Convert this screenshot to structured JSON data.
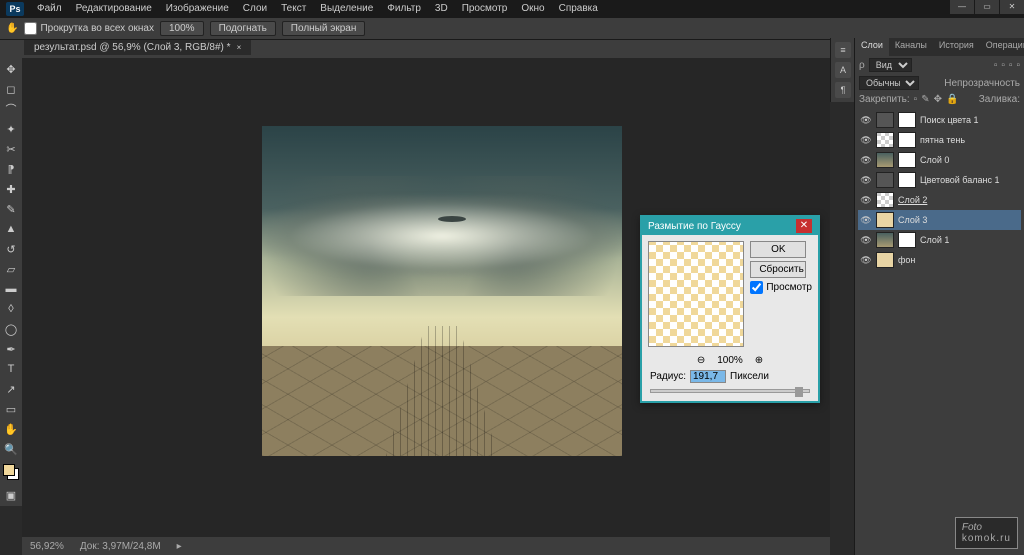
{
  "app": {
    "logo": "Ps"
  },
  "menu": [
    "Файл",
    "Редактирование",
    "Изображение",
    "Слои",
    "Текст",
    "Выделение",
    "Фильтр",
    "3D",
    "Просмотр",
    "Окно",
    "Справка"
  ],
  "options": {
    "scroll_all": "Прокрутка во всех окнах",
    "zoom": "100%",
    "fit": "Подогнать",
    "full": "Полный экран"
  },
  "doc_tab": "результат.psd @ 56,9% (Слой 3, RGB/8#) *",
  "dialog": {
    "title": "Размытие по Гауссу",
    "ok": "OK",
    "reset": "Сбросить",
    "preview": "Просмотр",
    "zoom": "100%",
    "radius_label": "Радиус:",
    "radius_value": "191,7",
    "radius_unit": "Пиксели"
  },
  "layers_panel": {
    "tabs": [
      "Слои",
      "Каналы",
      "История",
      "Операции"
    ],
    "kind_label": "Вид",
    "blend": "Обычные",
    "opacity_label": "Непрозрачность",
    "lock_label": "Закрепить:",
    "fill_label": "Заливка:",
    "layers": [
      {
        "name": "Поиск цвета 1",
        "thumb": "adj",
        "mask": true
      },
      {
        "name": "пятна тень",
        "thumb": "checker",
        "mask": true
      },
      {
        "name": "Слой 0",
        "thumb": "img",
        "mask": true
      },
      {
        "name": "Цветовой баланс 1",
        "thumb": "adj",
        "mask": true
      },
      {
        "name": "Слой 2",
        "thumb": "checker",
        "mask": false,
        "underline": true
      },
      {
        "name": "Слой 3",
        "thumb": "beige",
        "mask": false,
        "active": true
      },
      {
        "name": "Слой 1",
        "thumb": "img",
        "mask": true
      },
      {
        "name": "фон",
        "thumb": "beige",
        "mask": false
      }
    ]
  },
  "status": {
    "zoom": "56,92%",
    "doc": "Док: 3,97M/24,8M"
  },
  "watermark": {
    "line1": "Foto",
    "line2": "komok.ru"
  }
}
